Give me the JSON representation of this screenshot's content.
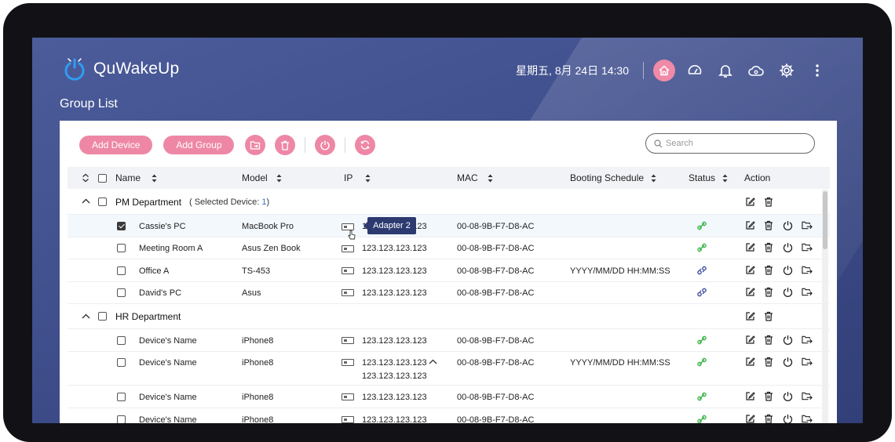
{
  "app": {
    "title": "QuWakeUp",
    "datetime": "星期五, 8月 24日 14:30"
  },
  "page": {
    "title": "Group List"
  },
  "toolbar": {
    "add_device": "Add Device",
    "add_group": "Add Group"
  },
  "search": {
    "placeholder": "Search"
  },
  "table": {
    "headers": {
      "name": "Name",
      "model": "Model",
      "ip": "IP",
      "mac": "MAC",
      "schedule": "Booting Schedule",
      "status": "Status",
      "action": "Action"
    },
    "groups": [
      {
        "name": "PM Department",
        "selected_prefix": "( Selected Device:",
        "selected_count": "1",
        "selected_suffix": ")"
      },
      {
        "name": "HR Department"
      }
    ],
    "rows": [
      {
        "name": "Cassie's PC",
        "model": "MacBook Pro",
        "ip": "123.123.123.123",
        "mac": "00-08-9B-F7-D8-AC",
        "schedule": "",
        "status": "online",
        "checked": true
      },
      {
        "name": "Meeting Room A",
        "model": "Asus Zen Book",
        "ip": "123.123.123.123",
        "mac": "00-08-9B-F7-D8-AC",
        "schedule": "",
        "status": "online",
        "checked": false
      },
      {
        "name": "Office A",
        "model": "TS-453",
        "ip": "123.123.123.123",
        "mac": "00-08-9B-F7-D8-AC",
        "schedule": "YYYY/MM/DD HH:MM:SS",
        "status": "offline",
        "checked": false
      },
      {
        "name": "David's PC",
        "model": "Asus",
        "ip": "123.123.123.123",
        "mac": "00-08-9B-F7-D8-AC",
        "schedule": "",
        "status": "offline",
        "checked": false
      },
      {
        "name": "Device's Name",
        "model": "iPhone8",
        "ip": "123.123.123.123",
        "mac": "00-08-9B-F7-D8-AC",
        "schedule": "",
        "status": "online",
        "checked": false
      },
      {
        "name": "Device's Name",
        "model": "iPhone8",
        "ip": "123.123.123.123",
        "ip2": "123.123.123.123",
        "mac": "00-08-9B-F7-D8-AC",
        "schedule": "YYYY/MM/DD HH:MM:SS",
        "status": "online",
        "checked": false
      },
      {
        "name": "Device's Name",
        "model": "iPhone8",
        "ip": "123.123.123.123",
        "mac": "00-08-9B-F7-D8-AC",
        "schedule": "",
        "status": "online",
        "checked": false
      },
      {
        "name": "Device's Name",
        "model": "iPhone8",
        "ip": "123.123.123.123",
        "mac": "00-08-9B-F7-D8-AC",
        "schedule": "",
        "status": "online",
        "checked": false
      }
    ]
  },
  "tooltip": {
    "text": "Adapter 2"
  },
  "colors": {
    "accent": "#ee87a6",
    "online": "#3cb54a",
    "offline": "#3a4a9c",
    "header_bg": "#3f4e8c"
  },
  "icons": {
    "header": [
      "home-icon",
      "dashboard-icon",
      "bell-icon",
      "cloud-icon",
      "gear-icon",
      "more-vertical-icon"
    ],
    "toolbar": [
      "move-to-group-icon",
      "trash-icon",
      "power-icon",
      "refresh-icon"
    ],
    "actions": [
      "edit-icon",
      "trash-icon",
      "power-icon",
      "move-icon"
    ]
  }
}
